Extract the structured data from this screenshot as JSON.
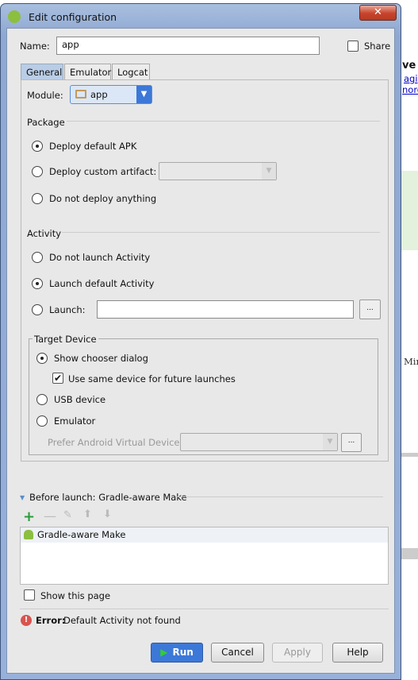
{
  "window": {
    "title": "Edit configuration",
    "close_label": "✕"
  },
  "background_text": [
    "ve A",
    "agi",
    "nore",
    "Mir"
  ],
  "name": {
    "label": "Name:",
    "value": "app"
  },
  "share": {
    "label": "Share",
    "checked": false
  },
  "tabs": [
    {
      "label": "General",
      "active": true
    },
    {
      "label": "Emulator"
    },
    {
      "label": "Logcat"
    }
  ],
  "module": {
    "label": "Module:",
    "value": "app"
  },
  "package": {
    "title": "Package",
    "options": [
      {
        "label": "Deploy default APK",
        "selected": true
      },
      {
        "label": "Deploy custom artifact:"
      },
      {
        "label": "Do not deploy anything"
      }
    ]
  },
  "activity": {
    "title": "Activity",
    "options": [
      {
        "label": "Do not launch Activity"
      },
      {
        "label": "Launch default Activity",
        "selected": true
      },
      {
        "label": "Launch:"
      }
    ],
    "launch_value": "",
    "browse_label": "..."
  },
  "target": {
    "title": "Target Device",
    "show_chooser": "Show chooser dialog",
    "use_same": "Use same device for future launches",
    "use_same_checked": true,
    "usb": "USB device",
    "emulator": "Emulator",
    "prefer_avd": "Prefer Android Virtual Device:",
    "browse_label": "..."
  },
  "before_launch": {
    "title": "Before launch: Gradle-aware Make",
    "items": [
      "Gradle-aware Make"
    ],
    "show_page": "Show this page"
  },
  "error": {
    "prefix": "Error:",
    "message": "Default Activity not found"
  },
  "buttons": {
    "run": "Run",
    "cancel": "Cancel",
    "apply": "Apply",
    "help": "Help"
  },
  "colors": {
    "accent": "#3c78d8",
    "android_green": "#8cbf3f",
    "error": "#d9534f"
  }
}
